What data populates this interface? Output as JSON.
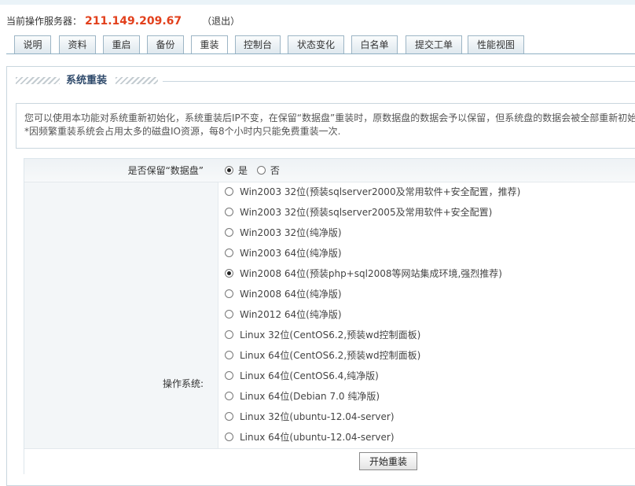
{
  "server": {
    "label": "当前操作服务器：",
    "ip": "211.149.209.67",
    "logout": "（退出）"
  },
  "tabs": [
    "说明",
    "资料",
    "重启",
    "备份",
    "重装",
    "控制台",
    "状态变化",
    "白名单",
    "提交工单",
    "性能视图"
  ],
  "active_tab": "重装",
  "section": {
    "title": "系统重装"
  },
  "notice": {
    "line1": "您可以使用本功能对系统重新初始化，系统重装后IP不变，在保留“数据盘”重装时，原数据盘的数据会予以保留，但系统盘的数据会被全部重新初始",
    "line2": "*因频繁重装系统会占用太多的磁盘IO资源，每8个小时内只能免费重装一次."
  },
  "form": {
    "keep_label": "是否保留“数据盘”",
    "keep_yes": "是",
    "keep_no": "否",
    "keep_selected": "是",
    "os_label": "操作系统:",
    "os_options": [
      "Win2003 32位(预装sqlserver2000及常用软件+安全配置，推荐)",
      "Win2003 32位(预装sqlserver2005及常用软件+安全配置)",
      "Win2003 32位(纯净版)",
      "Win2003 64位(纯净版)",
      "Win2008 64位(预装php+sql2008等网站集成环境,强烈推荐)",
      "Win2008 64位(纯净版)",
      "Win2012 64位(纯净版)",
      "Linux 32位(CentOS6.2,预装wd控制面板)",
      "Linux 64位(CentOS6.2,预装wd控制面板)",
      "Linux 64位(CentOS6.4,纯净版)",
      "Linux 64位(Debian 7.0 纯净版)",
      "Linux 32位(ubuntu-12.04-server)",
      "Linux 64位(ubuntu-12.04-server)"
    ],
    "os_selected": "Win2008 64位(预装php+sql2008等网站集成环境,强烈推荐)",
    "submit": "开始重装"
  }
}
